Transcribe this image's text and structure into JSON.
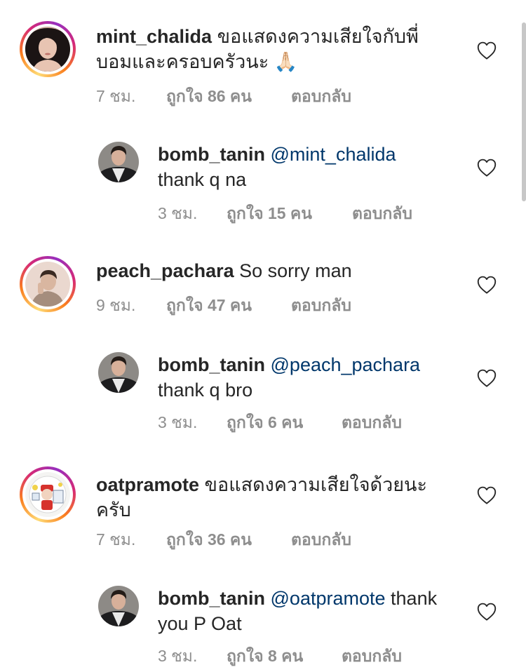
{
  "comments": [
    {
      "username": "mint_chalida",
      "text": "ขอแสดงความเสียใจกับพี่",
      "text_line2": "บอมและครอบครัวนะ 🙏🏻",
      "time": "7 ชม.",
      "likes": "ถูกใจ 86 คน",
      "reply": "ตอบกลับ"
    },
    {
      "username": "bomb_tanin",
      "mention": "@mint_chalida",
      "text": "thank q na",
      "time": "3 ชม.",
      "likes": "ถูกใจ 15 คน",
      "reply": "ตอบกลับ"
    },
    {
      "username": "peach_pachara",
      "text": "So sorry man",
      "time": "9 ชม.",
      "likes": "ถูกใจ 47 คน",
      "reply": "ตอบกลับ"
    },
    {
      "username": "bomb_tanin",
      "mention": "@peach_pachara",
      "text": "thank q bro",
      "time": "3 ชม.",
      "likes": "ถูกใจ 6 คน",
      "reply": "ตอบกลับ"
    },
    {
      "username": "oatpramote",
      "text": "ขอแสดงความเสียใจด้วยนะ",
      "text_line2": "ครับ",
      "time": "7 ชม.",
      "likes": "ถูกใจ 36 คน",
      "reply": "ตอบกลับ"
    },
    {
      "username": "bomb_tanin",
      "mention": "@oatpramote",
      "text": "thank",
      "text_line2": "you P Oat",
      "time": "3 ชม.",
      "likes": "ถูกใจ 8 คน",
      "reply": "ตอบกลับ"
    }
  ],
  "icons": {
    "like": "heart-outline-icon"
  },
  "colors": {
    "text": "#262626",
    "meta": "#8e8e8e",
    "mention": "#00376b",
    "story_ring": [
      "#feda75",
      "#fa7e1e",
      "#d62976",
      "#962fbf"
    ]
  }
}
